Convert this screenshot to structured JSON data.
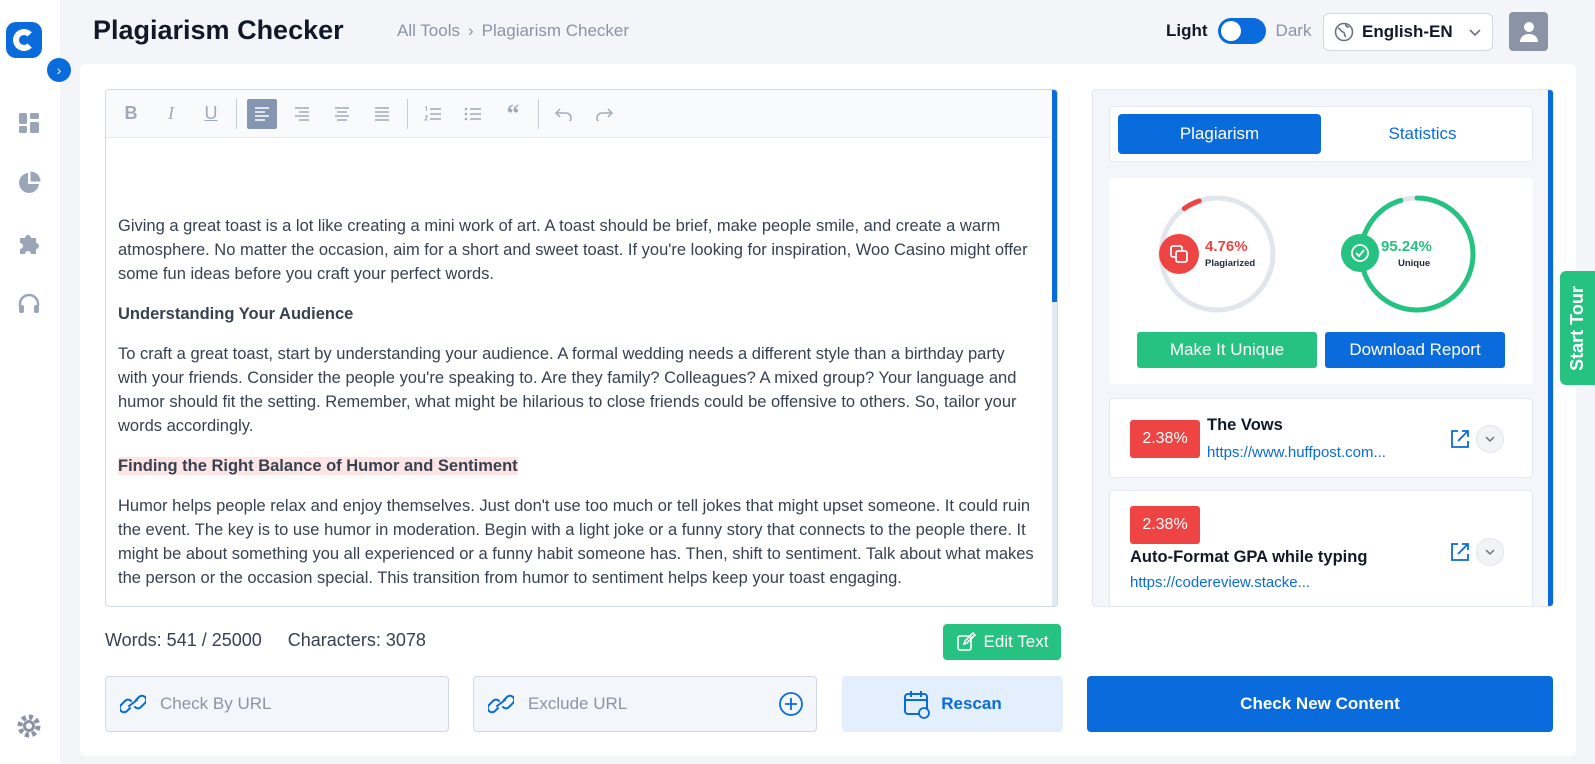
{
  "header": {
    "title": "Plagiarism Checker",
    "breadcrumb": [
      "All Tools",
      "Plagiarism Checker"
    ],
    "theme": {
      "light": "Light",
      "dark": "Dark"
    },
    "language": "English-EN"
  },
  "editor": {
    "paragraphs": [
      {
        "type": "p",
        "text": "Giving a great toast is a lot like creating a mini work of art. A toast should be brief, make people smile, and create a warm atmosphere. No matter the occasion, aim for a short and sweet toast. If you're looking for inspiration, Woo Casino might offer some fun ideas before you craft your perfect words."
      },
      {
        "type": "h",
        "text": "Understanding Your Audience"
      },
      {
        "type": "p",
        "text": "To craft a great toast, start by understanding your audience. A formal wedding needs a different style than a birthday party with your friends. Consider the people you're speaking to. Are they family? Colleagues? A mixed group? Your language and humor should fit the setting. Remember, what might be hilarious to close friends could be offensive to others. So, tailor your words accordingly."
      },
      {
        "type": "h-highlight",
        "text": "Finding the Right Balance of Humor and Sentiment"
      },
      {
        "type": "p",
        "text": "Humor helps people relax and enjoy themselves. Just don't use too much or tell jokes that might upset someone. It could ruin the event. The key is to use humor in moderation. Begin with a light joke or a funny story that connects to the people there. It might be about something you all experienced or a funny habit someone has. Then, shift to sentiment. Talk about what makes the person or the occasion special. This transition from humor to sentiment helps keep your toast engaging."
      }
    ],
    "words": "Words: 541 / 25000",
    "characters": "Characters: 3078",
    "edit_label": "Edit Text"
  },
  "bottom": {
    "check_url_placeholder": "Check By URL",
    "exclude_url_placeholder": "Exclude URL",
    "rescan_label": "Rescan",
    "check_new_label": "Check New Content"
  },
  "results": {
    "tabs": [
      "Plagiarism",
      "Statistics"
    ],
    "plagiarized": {
      "value": "4.76%",
      "label": "Plagiarized",
      "fraction": 0.0476
    },
    "unique": {
      "value": "95.24%",
      "label": "Unique",
      "fraction": 0.9524
    },
    "make_unique_label": "Make It Unique",
    "download_label": "Download Report",
    "sources": [
      {
        "pct": "2.38%",
        "title": "The Vows",
        "url": "https://www.huffpost.com..."
      },
      {
        "pct": "2.38%",
        "title": "Auto-Format GPA while typing",
        "url": "https://codereview.stacke..."
      }
    ]
  },
  "start_tour": "Start Tour",
  "colors": {
    "primary": "#0a6bdc",
    "success": "#25c281",
    "danger": "#ef4444"
  }
}
